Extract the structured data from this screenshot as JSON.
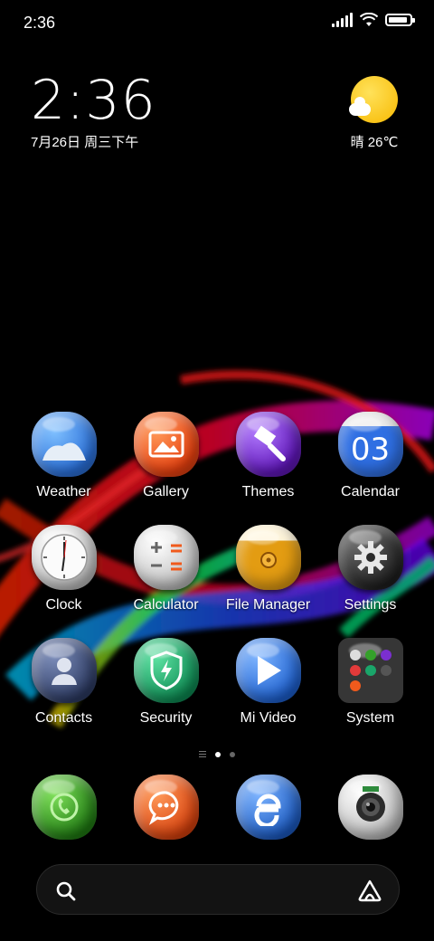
{
  "status_bar": {
    "time": "2:36",
    "signal_icon": "signal-bars-icon",
    "wifi_icon": "wifi-icon",
    "battery_icon": "battery-icon",
    "battery_level": 0.9
  },
  "clock_widget": {
    "time": "2:36",
    "date": "7月26日 周三下午"
  },
  "weather_widget": {
    "icon": "sun-cloud-icon",
    "text": "晴 26℃"
  },
  "apps": [
    {
      "label": "Weather",
      "icon": "weather-icon",
      "color": "#3a86e8"
    },
    {
      "label": "Gallery",
      "icon": "gallery-icon",
      "color": "#f0561f"
    },
    {
      "label": "Themes",
      "icon": "themes-icon",
      "color": "#7b2fd0"
    },
    {
      "label": "Calendar",
      "icon": "calendar-icon",
      "color": "#2e6fe0",
      "badge_text": "03"
    },
    {
      "label": "Clock",
      "icon": "clock-icon",
      "color": "#e8e8e8"
    },
    {
      "label": "Calculator",
      "icon": "calculator-icon",
      "color": "#dcdcdc"
    },
    {
      "label": "File Manager",
      "icon": "folder-icon",
      "color": "#e6a21a"
    },
    {
      "label": "Settings",
      "icon": "gear-icon",
      "color": "#3a3a3a"
    },
    {
      "label": "Contacts",
      "icon": "contacts-icon",
      "color": "#3e4f7a"
    },
    {
      "label": "Security",
      "icon": "shield-icon",
      "color": "#1aa56a"
    },
    {
      "label": "Mi Video",
      "icon": "play-icon",
      "color": "#2b74e3"
    },
    {
      "label": "System",
      "icon": "folder-icon",
      "color": "#2a2a2a"
    }
  ],
  "page_indicator": {
    "pages": 2,
    "active": 1
  },
  "dock": [
    {
      "icon": "phone-icon",
      "color": "#34a02a"
    },
    {
      "icon": "messages-icon",
      "color": "#f05a1c"
    },
    {
      "icon": "browser-icon",
      "color": "#2f73d8"
    },
    {
      "icon": "camera-icon",
      "color": "#e4e4e4"
    }
  ],
  "search_bar": {
    "search_icon": "search-icon",
    "assistant_icon": "assistant-icon"
  }
}
